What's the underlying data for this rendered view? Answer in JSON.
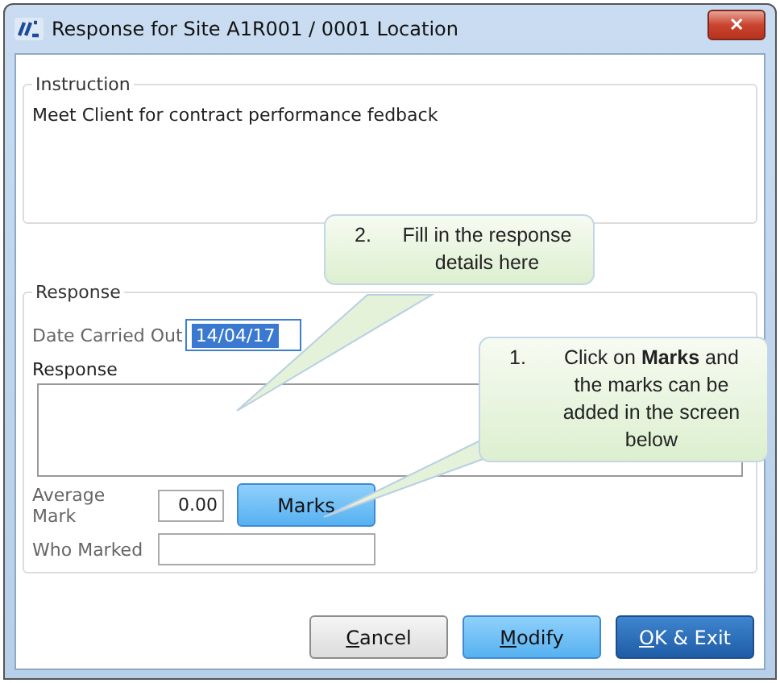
{
  "window": {
    "title": "Response for Site A1R001 / 0001 Location",
    "close": "✕"
  },
  "instruction": {
    "legend": "Instruction",
    "text": "Meet Client for contract performance fedback"
  },
  "response": {
    "legend": "Response",
    "date_label": "Date Carried Out",
    "date_value": "14/04/17",
    "date_selected": true,
    "response_label": "Response",
    "average_label": "Average Mark",
    "average_value": "0.00",
    "marks_button": "Marks",
    "who_label": "Who Marked"
  },
  "buttons": [
    {
      "kind": "plain",
      "key": "C",
      "rest": "ancel"
    },
    {
      "kind": "accent",
      "key": "M",
      "rest": "odify"
    },
    {
      "kind": "default",
      "key": "O",
      "rest": "K & Exit"
    }
  ],
  "callouts": [
    {
      "number": "2.",
      "text": "Fill in the response details here"
    },
    {
      "number": "1.",
      "text": "Click on **Marks** and the marks can be added in the screen below"
    }
  ]
}
